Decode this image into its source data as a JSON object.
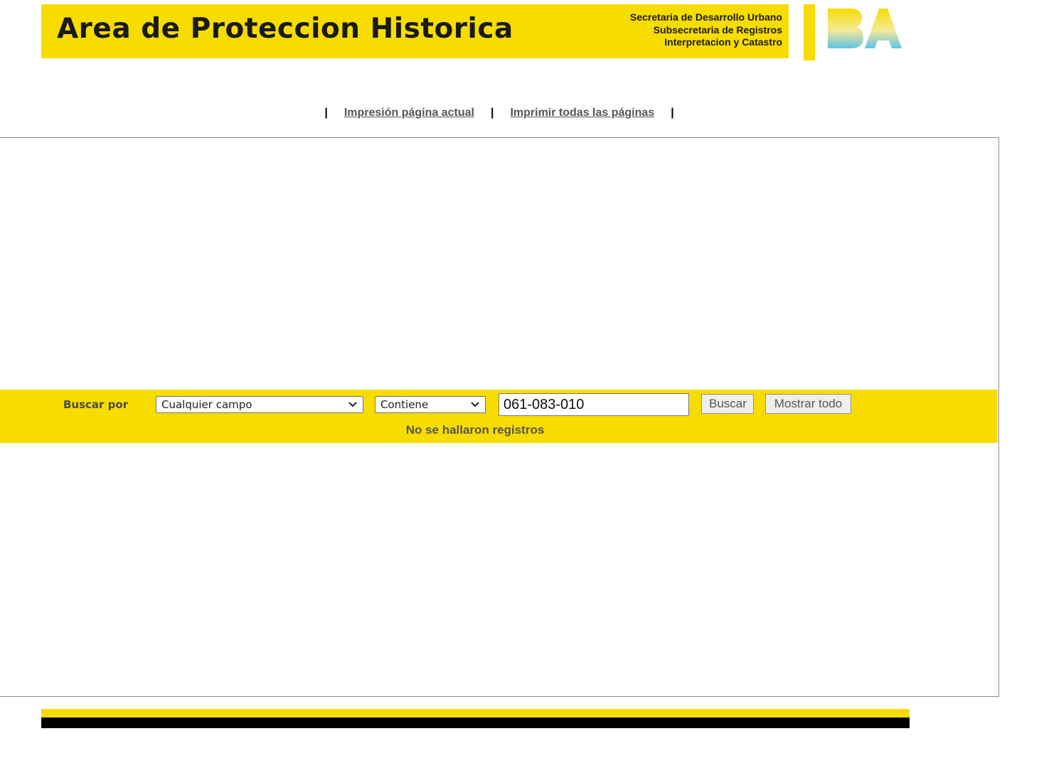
{
  "header": {
    "title": "Area de Proteccion Historica",
    "org_lines": [
      "Secretaria de Desarrollo Urbano",
      "Subsecretaria de Registros",
      "Interpretacion y Catastro"
    ],
    "logo_text": "BA",
    "logo_icon": "ba-logo-icon",
    "brand_color": "#f7dc00"
  },
  "print_links": {
    "separator": "|",
    "current_page": "Impresión página actual",
    "all_pages": "Imprimir todas las páginas"
  },
  "search": {
    "label": "Buscar por",
    "field_select": "Cualquier campo",
    "operator_select": "Contiene",
    "query_value": "061-083-010",
    "search_button": "Buscar",
    "show_all_button": "Mostrar todo",
    "result_message": "No se hallaron registros",
    "dropdown_icon": "chevron-down-icon"
  },
  "colors": {
    "accent_yellow": "#f7dc00",
    "footer_black": "#000000",
    "link_gray": "#555555"
  }
}
